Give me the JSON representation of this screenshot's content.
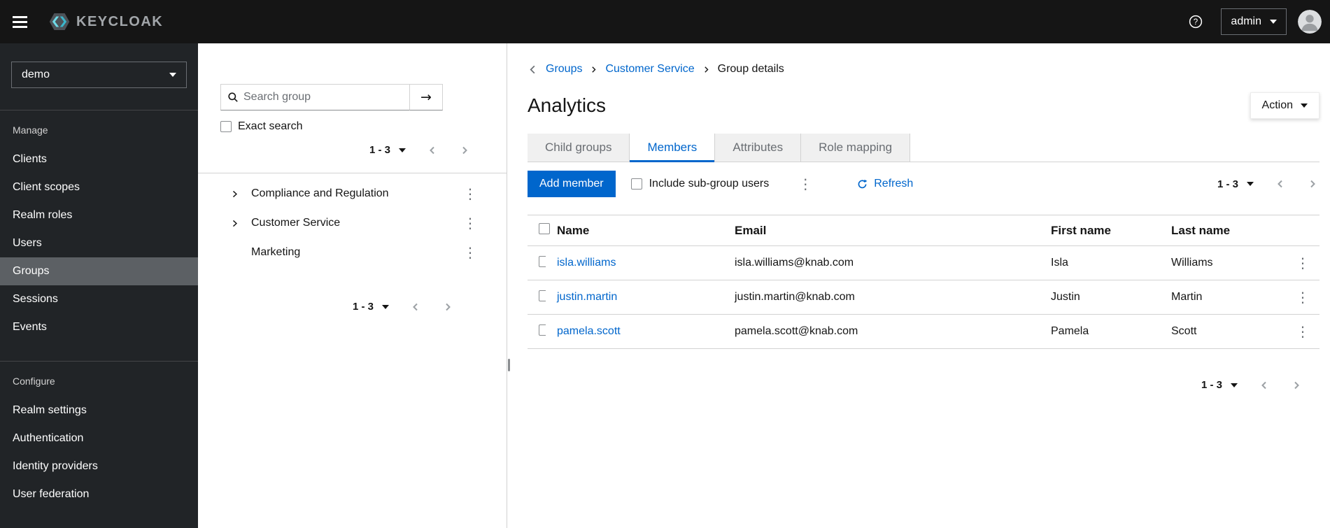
{
  "colors": {
    "accent_blue": "#0066cc",
    "masthead_bg": "#151515",
    "sidebar_bg": "#212427",
    "sidebar_selected_bg": "#5c6064",
    "border_gray": "#d2d2d2",
    "muted_text": "#6a6e73",
    "brand_cyan": "#3bb7cc"
  },
  "icons": {
    "kebab": "⋮",
    "search_go_arrow": "→"
  },
  "masthead": {
    "brand": "KEYCLOAK",
    "user_menu": "admin"
  },
  "sidebar": {
    "realm_selector": "demo",
    "selected_item": "Groups",
    "sections": [
      {
        "label": "Manage",
        "items": [
          "Clients",
          "Client scopes",
          "Realm roles",
          "Users",
          "Groups",
          "Sessions",
          "Events"
        ]
      },
      {
        "label": "Configure",
        "items": [
          "Realm settings",
          "Authentication",
          "Identity providers",
          "User federation"
        ]
      }
    ]
  },
  "groups_panel": {
    "search_placeholder": "Search group",
    "exact_search_label": "Exact search",
    "pagination_top": "1 - 3",
    "pagination_bottom": "1 - 3",
    "tree": [
      {
        "label": "Compliance and Regulation",
        "expandable": true
      },
      {
        "label": "Customer Service",
        "expandable": true
      },
      {
        "label": "Marketing",
        "expandable": false
      }
    ]
  },
  "main": {
    "breadcrumb": {
      "items": [
        "Groups",
        "Customer Service",
        "Group details"
      ]
    },
    "title": "Analytics",
    "action_button": "Action",
    "tabs": [
      "Child groups",
      "Members",
      "Attributes",
      "Role mapping"
    ],
    "active_tab": "Members",
    "toolbar": {
      "add_member": "Add member",
      "include_subgroups": "Include sub-group users",
      "refresh": "Refresh",
      "pagination": "1 - 3"
    },
    "table": {
      "headers": [
        "Name",
        "Email",
        "First name",
        "Last name"
      ],
      "rows": [
        {
          "name": "isla.williams",
          "email": "isla.williams@knab.com",
          "first_name": "Isla",
          "last_name": "Williams"
        },
        {
          "name": "justin.martin",
          "email": "justin.martin@knab.com",
          "first_name": "Justin",
          "last_name": "Martin"
        },
        {
          "name": "pamela.scott",
          "email": "pamela.scott@knab.com",
          "first_name": "Pamela",
          "last_name": "Scott"
        }
      ]
    },
    "pagination_bottom": "1 - 3"
  }
}
